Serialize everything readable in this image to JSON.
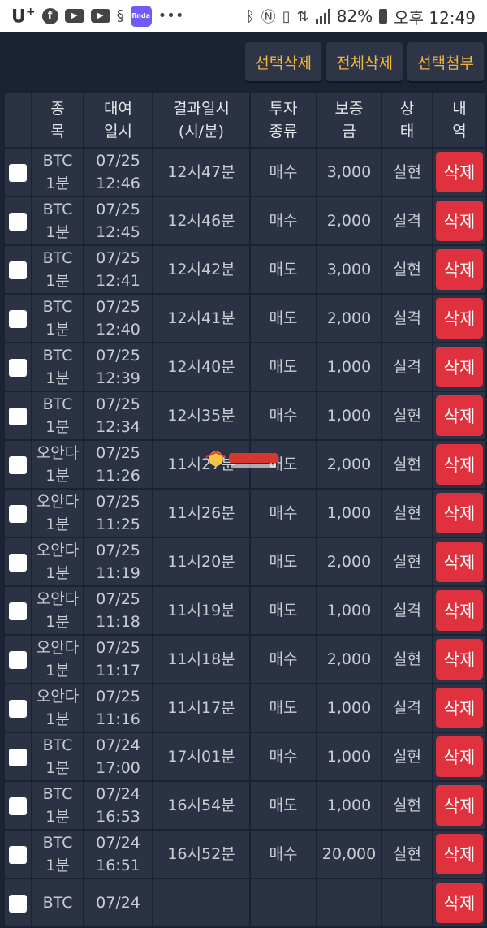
{
  "status_bar": {
    "carrier": "U",
    "carrier_sup": "+",
    "app_badge": "finda",
    "more": "•••",
    "battery": "82%",
    "time": "오후 12:49"
  },
  "toolbar": {
    "select_delete": "선택삭제",
    "delete_all": "전체삭제",
    "select_attach": "선택첨부"
  },
  "table": {
    "headers": {
      "item": [
        "종",
        "목"
      ],
      "rent_time": [
        "대여",
        "일시"
      ],
      "result_time": [
        "결과일시",
        "(시/분)"
      ],
      "type": [
        "투자",
        "종류"
      ],
      "deposit": [
        "보증",
        "금"
      ],
      "status": [
        "상",
        "태"
      ],
      "history": [
        "내",
        "역"
      ]
    },
    "delete_label": "삭제",
    "rows": [
      {
        "item": [
          "BTC",
          "1분"
        ],
        "date": [
          "07/25",
          "12:46"
        ],
        "result": "12시47분",
        "type": "매수",
        "amount": "3,000",
        "status": "실현",
        "win": true
      },
      {
        "item": [
          "BTC",
          "1분"
        ],
        "date": [
          "07/25",
          "12:45"
        ],
        "result": "12시46분",
        "type": "매수",
        "amount": "2,000",
        "status": "실격",
        "win": false
      },
      {
        "item": [
          "BTC",
          "1분"
        ],
        "date": [
          "07/25",
          "12:41"
        ],
        "result": "12시42분",
        "type": "매도",
        "amount": "3,000",
        "status": "실현",
        "win": true
      },
      {
        "item": [
          "BTC",
          "1분"
        ],
        "date": [
          "07/25",
          "12:40"
        ],
        "result": "12시41분",
        "type": "매도",
        "amount": "2,000",
        "status": "실격",
        "win": false
      },
      {
        "item": [
          "BTC",
          "1분"
        ],
        "date": [
          "07/25",
          "12:39"
        ],
        "result": "12시40분",
        "type": "매도",
        "amount": "1,000",
        "status": "실격",
        "win": false
      },
      {
        "item": [
          "BTC",
          "1분"
        ],
        "date": [
          "07/25",
          "12:34"
        ],
        "result": "12시35분",
        "type": "매수",
        "amount": "1,000",
        "status": "실현",
        "win": true
      },
      {
        "item": [
          "오안다",
          "1분"
        ],
        "date": [
          "07/25",
          "11:26"
        ],
        "result": "11시27분",
        "type": "매도",
        "amount": "2,000",
        "status": "실현",
        "win": true
      },
      {
        "item": [
          "오안다",
          "1분"
        ],
        "date": [
          "07/25",
          "11:25"
        ],
        "result": "11시26분",
        "type": "매수",
        "amount": "1,000",
        "status": "실현",
        "win": true
      },
      {
        "item": [
          "오안다",
          "1분"
        ],
        "date": [
          "07/25",
          "11:19"
        ],
        "result": "11시20분",
        "type": "매도",
        "amount": "2,000",
        "status": "실현",
        "win": true
      },
      {
        "item": [
          "오안다",
          "1분"
        ],
        "date": [
          "07/25",
          "11:18"
        ],
        "result": "11시19분",
        "type": "매도",
        "amount": "1,000",
        "status": "실격",
        "win": false
      },
      {
        "item": [
          "오안다",
          "1분"
        ],
        "date": [
          "07/25",
          "11:17"
        ],
        "result": "11시18분",
        "type": "매수",
        "amount": "2,000",
        "status": "실현",
        "win": true
      },
      {
        "item": [
          "오안다",
          "1분"
        ],
        "date": [
          "07/25",
          "11:16"
        ],
        "result": "11시17분",
        "type": "매도",
        "amount": "1,000",
        "status": "실격",
        "win": false
      },
      {
        "item": [
          "BTC",
          "1분"
        ],
        "date": [
          "07/24",
          "17:00"
        ],
        "result": "17시01분",
        "type": "매수",
        "amount": "1,000",
        "status": "실현",
        "win": true
      },
      {
        "item": [
          "BTC",
          "1분"
        ],
        "date": [
          "07/24",
          "16:53"
        ],
        "result": "16시54분",
        "type": "매도",
        "amount": "1,000",
        "status": "실현",
        "win": true
      },
      {
        "item": [
          "BTC",
          "1분"
        ],
        "date": [
          "07/24",
          "16:51"
        ],
        "result": "16시52분",
        "type": "매수",
        "amount": "20,000",
        "status": "실현",
        "win": true
      },
      {
        "item": [
          "BTC",
          ""
        ],
        "date": [
          "07/24",
          ""
        ],
        "result": "",
        "type": "",
        "amount": "",
        "status": "",
        "win": true
      }
    ]
  },
  "colors": {
    "win": "#4caf50",
    "lose": "#e53935",
    "accent": "#f0b43c",
    "delete": "#e0323e"
  }
}
